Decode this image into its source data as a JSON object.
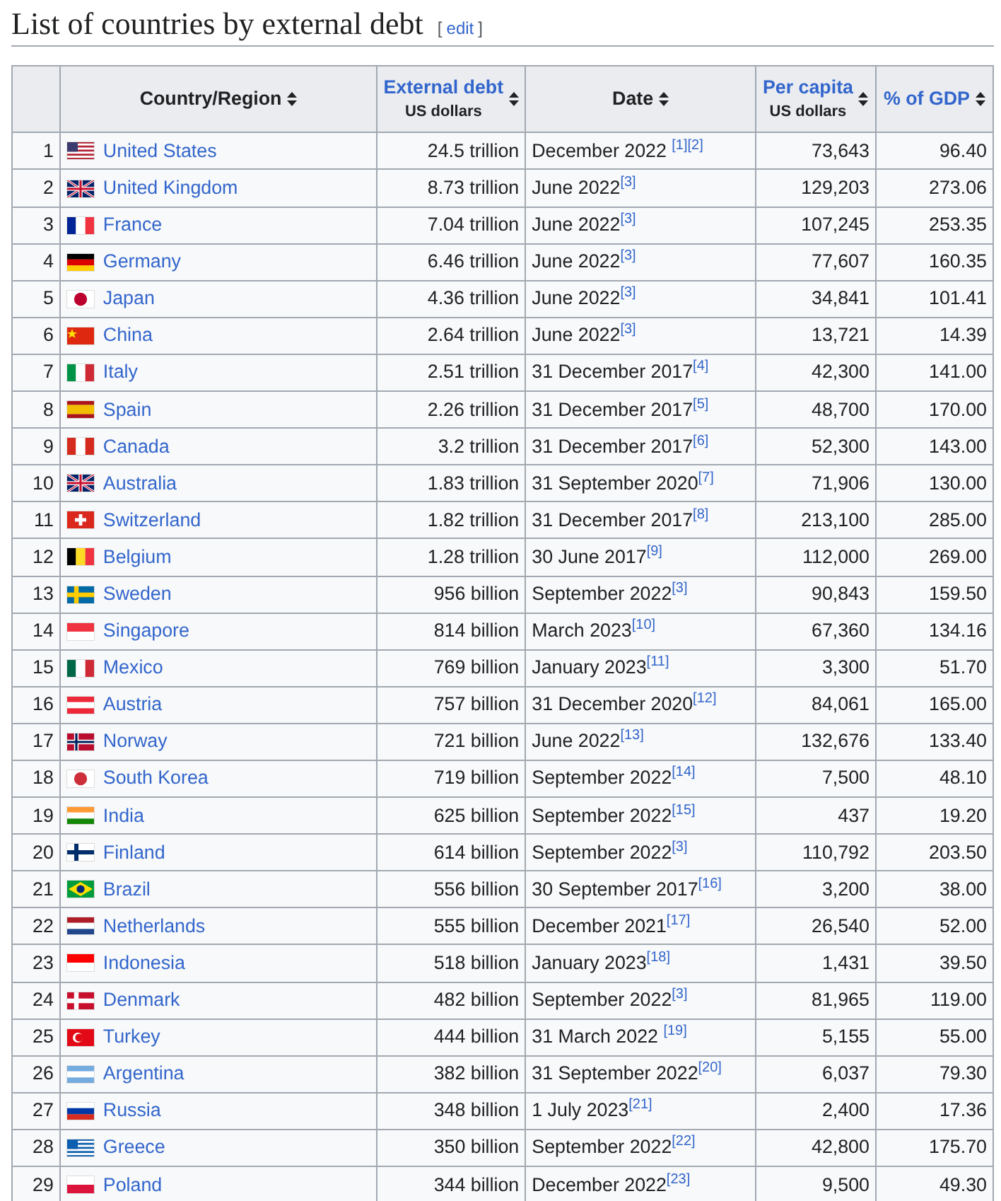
{
  "heading": {
    "title": "List of countries by external debt",
    "edit_open": "[",
    "edit_link": "edit",
    "edit_close": "]"
  },
  "columns": [
    {
      "label": "Country/Region",
      "link": false
    },
    {
      "label": "External debt",
      "sub": "US dollars",
      "link": true
    },
    {
      "label": "Date",
      "link": false
    },
    {
      "label": "Per capita",
      "sub": "US dollars",
      "link": true
    },
    {
      "label": "% of GDP",
      "link": true
    }
  ],
  "rows": [
    {
      "rank": "1",
      "country": "United States",
      "flag": {
        "kind": "canton",
        "color": "#b22234"
      },
      "debt": "24.5 trillion",
      "date": "December 2022 ",
      "refs": [
        "[1]",
        "[2]"
      ],
      "per_capita": "73,643",
      "pct_gdp": "96.40"
    },
    {
      "rank": "2",
      "country": "United Kingdom",
      "flag": {
        "kind": "union",
        "color": "#012169"
      },
      "debt": "8.73 trillion",
      "date": "June 2022",
      "refs": [
        "[3]"
      ],
      "per_capita": "129,203",
      "pct_gdp": "273.06"
    },
    {
      "rank": "3",
      "country": "France",
      "flag": {
        "kind": "v3",
        "color": "#002395"
      },
      "debt": "7.04 trillion",
      "date": "June 2022",
      "refs": [
        "[3]"
      ],
      "per_capita": "107,245",
      "pct_gdp": "253.35"
    },
    {
      "rank": "4",
      "country": "Germany",
      "flag": {
        "kind": "h3dark",
        "color": "#dd0000"
      },
      "debt": "6.46 trillion",
      "date": "June 2022",
      "refs": [
        "[3]"
      ],
      "per_capita": "77,607",
      "pct_gdp": "160.35"
    },
    {
      "rank": "5",
      "country": "Japan",
      "flag": {
        "kind": "disc",
        "color": "#bc002d"
      },
      "debt": "4.36 trillion",
      "date": "June 2022",
      "refs": [
        "[3]"
      ],
      "per_capita": "34,841",
      "pct_gdp": "101.41"
    },
    {
      "rank": "6",
      "country": "China",
      "flag": {
        "kind": "star",
        "color": "#de2910"
      },
      "debt": "2.64 trillion",
      "date": "June 2022",
      "refs": [
        "[3]"
      ],
      "per_capita": "13,721",
      "pct_gdp": "14.39"
    },
    {
      "rank": "7",
      "country": "Italy",
      "flag": {
        "kind": "v3",
        "color": "#009246"
      },
      "debt": "2.51 trillion",
      "date": "31 December 2017",
      "refs": [
        "[4]"
      ],
      "per_capita": "42,300",
      "pct_gdp": "141.00"
    },
    {
      "rank": "8",
      "country": "Spain",
      "flag": {
        "kind": "band",
        "color": "#aa151b"
      },
      "debt": "2.26 trillion",
      "date": "31 December 2017",
      "refs": [
        "[5]"
      ],
      "per_capita": "48,700",
      "pct_gdp": "170.00"
    },
    {
      "rank": "9",
      "country": "Canada",
      "flag": {
        "kind": "v3",
        "color": "#d52b1e"
      },
      "debt": "3.2 trillion",
      "date": "31 December 2017",
      "refs": [
        "[6]"
      ],
      "per_capita": "52,300",
      "pct_gdp": "143.00"
    },
    {
      "rank": "10",
      "country": "Australia",
      "flag": {
        "kind": "union",
        "color": "#012169"
      },
      "debt": "1.83 trillion",
      "date": "31 September 2020",
      "refs": [
        "[7]"
      ],
      "per_capita": "71,906",
      "pct_gdp": "130.00"
    },
    {
      "rank": "11",
      "country": "Switzerland",
      "flag": {
        "kind": "plus",
        "color": "#da291c"
      },
      "debt": "1.82 trillion",
      "date": "31 December 2017",
      "refs": [
        "[8]"
      ],
      "per_capita": "213,100",
      "pct_gdp": "285.00"
    },
    {
      "rank": "12",
      "country": "Belgium",
      "flag": {
        "kind": "v3",
        "color": "#000000"
      },
      "debt": "1.28 trillion",
      "date": "30 June 2017",
      "refs": [
        "[9]"
      ],
      "per_capita": "112,000",
      "pct_gdp": "269.00"
    },
    {
      "rank": "13",
      "country": "Sweden",
      "flag": {
        "kind": "cross",
        "color": "#006aa7"
      },
      "debt": "956 billion",
      "date": "September 2022",
      "refs": [
        "[3]"
      ],
      "per_capita": "90,843",
      "pct_gdp": "159.50"
    },
    {
      "rank": "14",
      "country": "Singapore",
      "flag": {
        "kind": "h2",
        "color": "#ef3340"
      },
      "debt": "814 billion",
      "date": "March 2023",
      "refs": [
        "[10]"
      ],
      "per_capita": "67,360",
      "pct_gdp": "134.16"
    },
    {
      "rank": "15",
      "country": "Mexico",
      "flag": {
        "kind": "v3",
        "color": "#006847"
      },
      "debt": "769 billion",
      "date": "January 2023",
      "refs": [
        "[11]"
      ],
      "per_capita": "3,300",
      "pct_gdp": "51.70"
    },
    {
      "rank": "16",
      "country": "Austria",
      "flag": {
        "kind": "h3",
        "color": "#ed2939"
      },
      "debt": "757 billion",
      "date": "31 December 2020",
      "refs": [
        "[12]"
      ],
      "per_capita": "84,061",
      "pct_gdp": "165.00"
    },
    {
      "rank": "17",
      "country": "Norway",
      "flag": {
        "kind": "cross",
        "color": "#ba0c2f"
      },
      "debt": "721 billion",
      "date": "June 2022",
      "refs": [
        "[13]"
      ],
      "per_capita": "132,676",
      "pct_gdp": "133.40"
    },
    {
      "rank": "18",
      "country": "South Korea",
      "flag": {
        "kind": "disc",
        "color": "#cd2e3a"
      },
      "debt": "719 billion",
      "date": "September 2022",
      "refs": [
        "[14]"
      ],
      "per_capita": "7,500",
      "pct_gdp": "48.10"
    },
    {
      "rank": "19",
      "country": "India",
      "flag": {
        "kind": "h3tri",
        "color": "#ff9933"
      },
      "debt": "625 billion",
      "date": "September 2022",
      "refs": [
        "[15]"
      ],
      "per_capita": "437",
      "pct_gdp": "19.20"
    },
    {
      "rank": "20",
      "country": "Finland",
      "flag": {
        "kind": "cross-light",
        "color": "#002f6c"
      },
      "debt": "614 billion",
      "date": "September 2022",
      "refs": [
        "[3]"
      ],
      "per_capita": "110,792",
      "pct_gdp": "203.50"
    },
    {
      "rank": "21",
      "country": "Brazil",
      "flag": {
        "kind": "diamond",
        "color": "#009c3b"
      },
      "debt": "556 billion",
      "date": "30 September 2017",
      "refs": [
        "[16]"
      ],
      "per_capita": "3,200",
      "pct_gdp": "38.00"
    },
    {
      "rank": "22",
      "country": "Netherlands",
      "flag": {
        "kind": "h3tri",
        "color": "#ae1c28"
      },
      "debt": "555 billion",
      "date": "December 2021",
      "refs": [
        "[17]"
      ],
      "per_capita": "26,540",
      "pct_gdp": "52.00"
    },
    {
      "rank": "23",
      "country": "Indonesia",
      "flag": {
        "kind": "h2",
        "color": "#ff0000"
      },
      "debt": "518 billion",
      "date": "January 2023",
      "refs": [
        "[18]"
      ],
      "per_capita": "1,431",
      "pct_gdp": "39.50"
    },
    {
      "rank": "24",
      "country": "Denmark",
      "flag": {
        "kind": "cross",
        "color": "#c8102e"
      },
      "debt": "482 billion",
      "date": "September 2022",
      "refs": [
        "[3]"
      ],
      "per_capita": "81,965",
      "pct_gdp": "119.00"
    },
    {
      "rank": "25",
      "country": "Turkey",
      "flag": {
        "kind": "crescent",
        "color": "#e30a17"
      },
      "debt": "444 billion",
      "date": "31 March 2022 ",
      "refs": [
        "[19]"
      ],
      "per_capita": "5,155",
      "pct_gdp": "55.00"
    },
    {
      "rank": "26",
      "country": "Argentina",
      "flag": {
        "kind": "h3",
        "color": "#74acdf"
      },
      "debt": "382 billion",
      "date": "31 September 2022",
      "refs": [
        "[20]"
      ],
      "per_capita": "6,037",
      "pct_gdp": "79.30"
    },
    {
      "rank": "27",
      "country": "Russia",
      "flag": {
        "kind": "h3white",
        "color": "#0039a6"
      },
      "debt": "348 billion",
      "date": "1 July 2023",
      "refs": [
        "[21]"
      ],
      "per_capita": "2,400",
      "pct_gdp": "17.36"
    },
    {
      "rank": "28",
      "country": "Greece",
      "flag": {
        "kind": "canton",
        "color": "#0d5eaf"
      },
      "debt": "350 billion",
      "date": "September 2022",
      "refs": [
        "[22]"
      ],
      "per_capita": "42,800",
      "pct_gdp": "175.70"
    },
    {
      "rank": "29",
      "country": "Poland",
      "flag": {
        "kind": "h2low",
        "color": "#dc143c"
      },
      "debt": "344 billion",
      "date": "December 2022",
      "refs": [
        "[23]"
      ],
      "per_capita": "9,500",
      "pct_gdp": "49.30"
    }
  ]
}
